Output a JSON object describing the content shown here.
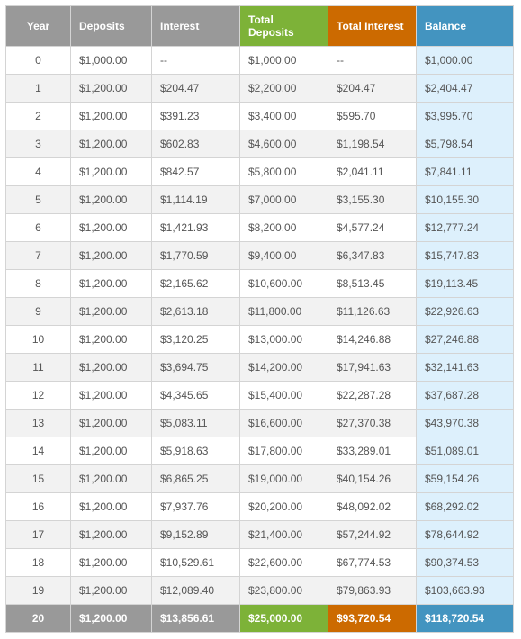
{
  "headers": [
    "Year",
    "Deposits",
    "Interest",
    "Total Deposits",
    "Total Interest",
    "Balance"
  ],
  "header_colors": {
    "gray": "#999999",
    "green": "#7db238",
    "orange": "#cc6a00",
    "blue": "#4394c0",
    "balance_bg": "#ddf0fc"
  },
  "rows": [
    [
      "0",
      "$1,000.00",
      "--",
      "$1,000.00",
      "--",
      "$1,000.00"
    ],
    [
      "1",
      "$1,200.00",
      "$204.47",
      "$2,200.00",
      "$204.47",
      "$2,404.47"
    ],
    [
      "2",
      "$1,200.00",
      "$391.23",
      "$3,400.00",
      "$595.70",
      "$3,995.70"
    ],
    [
      "3",
      "$1,200.00",
      "$602.83",
      "$4,600.00",
      "$1,198.54",
      "$5,798.54"
    ],
    [
      "4",
      "$1,200.00",
      "$842.57",
      "$5,800.00",
      "$2,041.11",
      "$7,841.11"
    ],
    [
      "5",
      "$1,200.00",
      "$1,114.19",
      "$7,000.00",
      "$3,155.30",
      "$10,155.30"
    ],
    [
      "6",
      "$1,200.00",
      "$1,421.93",
      "$8,200.00",
      "$4,577.24",
      "$12,777.24"
    ],
    [
      "7",
      "$1,200.00",
      "$1,770.59",
      "$9,400.00",
      "$6,347.83",
      "$15,747.83"
    ],
    [
      "8",
      "$1,200.00",
      "$2,165.62",
      "$10,600.00",
      "$8,513.45",
      "$19,113.45"
    ],
    [
      "9",
      "$1,200.00",
      "$2,613.18",
      "$11,800.00",
      "$11,126.63",
      "$22,926.63"
    ],
    [
      "10",
      "$1,200.00",
      "$3,120.25",
      "$13,000.00",
      "$14,246.88",
      "$27,246.88"
    ],
    [
      "11",
      "$1,200.00",
      "$3,694.75",
      "$14,200.00",
      "$17,941.63",
      "$32,141.63"
    ],
    [
      "12",
      "$1,200.00",
      "$4,345.65",
      "$15,400.00",
      "$22,287.28",
      "$37,687.28"
    ],
    [
      "13",
      "$1,200.00",
      "$5,083.11",
      "$16,600.00",
      "$27,370.38",
      "$43,970.38"
    ],
    [
      "14",
      "$1,200.00",
      "$5,918.63",
      "$17,800.00",
      "$33,289.01",
      "$51,089.01"
    ],
    [
      "15",
      "$1,200.00",
      "$6,865.25",
      "$19,000.00",
      "$40,154.26",
      "$59,154.26"
    ],
    [
      "16",
      "$1,200.00",
      "$7,937.76",
      "$20,200.00",
      "$48,092.02",
      "$68,292.02"
    ],
    [
      "17",
      "$1,200.00",
      "$9,152.89",
      "$21,400.00",
      "$57,244.92",
      "$78,644.92"
    ],
    [
      "18",
      "$1,200.00",
      "$10,529.61",
      "$22,600.00",
      "$67,774.53",
      "$90,374.53"
    ],
    [
      "19",
      "$1,200.00",
      "$12,089.40",
      "$23,800.00",
      "$79,863.93",
      "$103,663.93"
    ]
  ],
  "footer": [
    "20",
    "$1,200.00",
    "$13,856.61",
    "$25,000.00",
    "$93,720.54",
    "$118,720.54"
  ]
}
